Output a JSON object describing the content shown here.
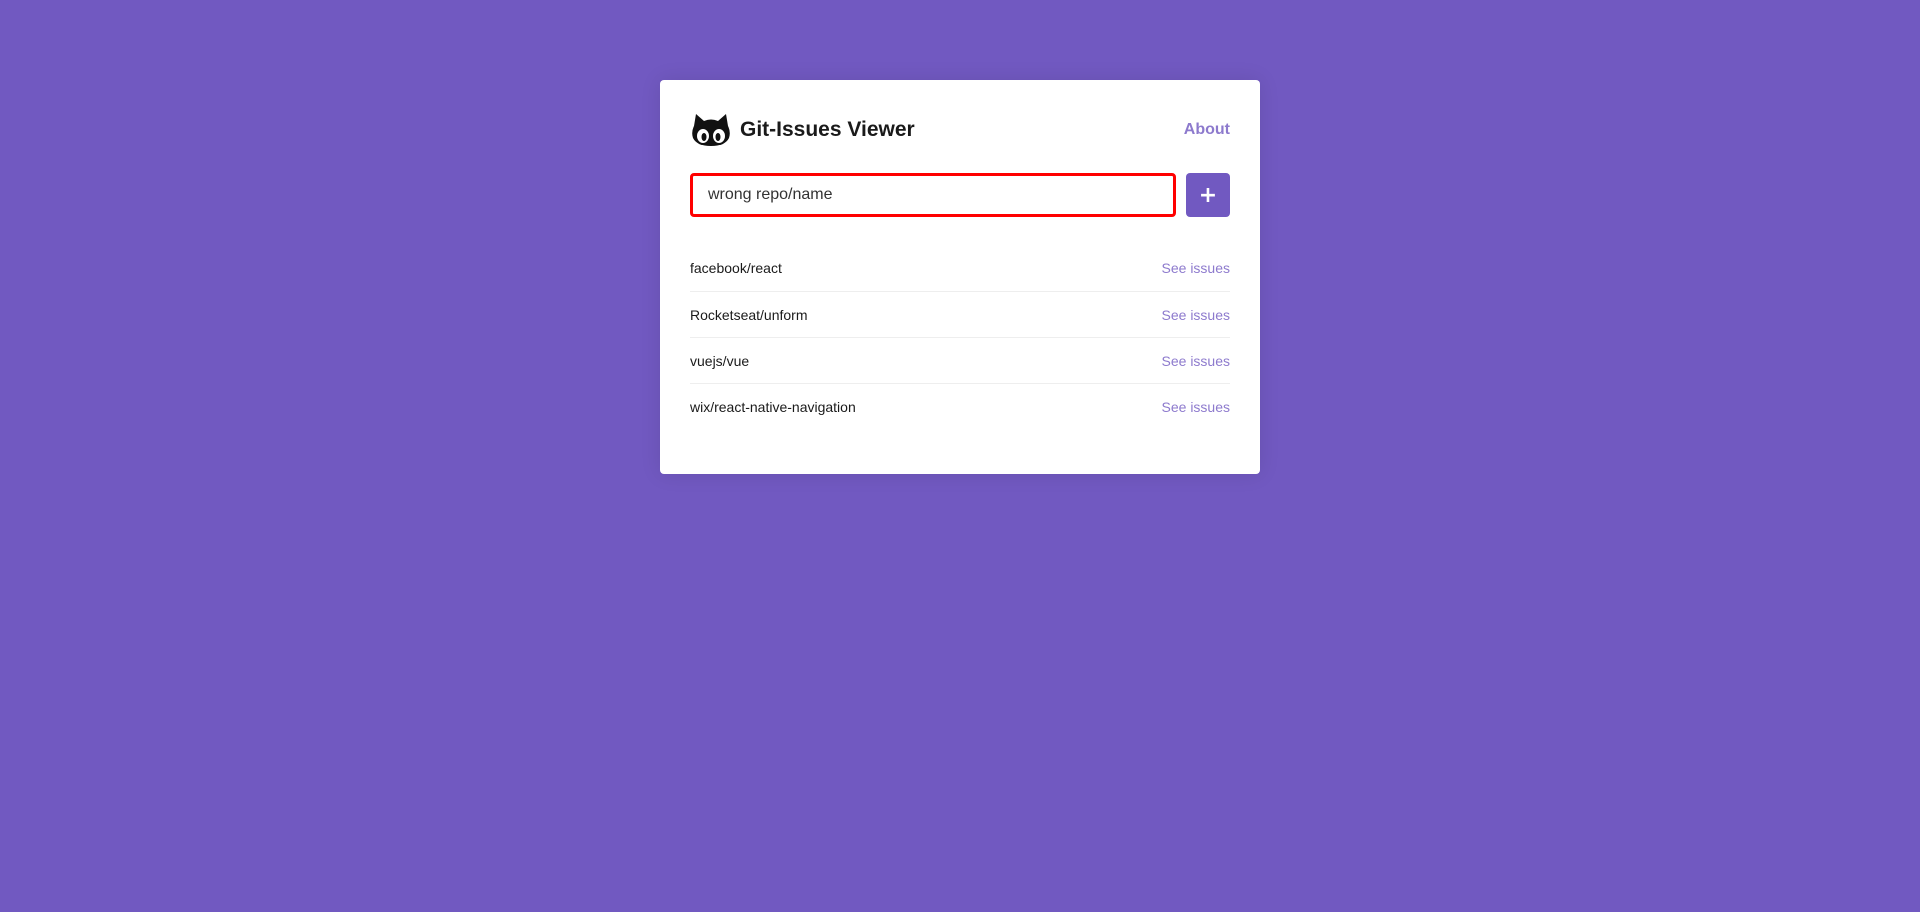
{
  "app": {
    "title": "Git-Issues Viewer",
    "about_label": "About",
    "logo_icon": "octocat-icon"
  },
  "form": {
    "input_value": "wrong repo/name",
    "input_state": "error",
    "add_button_label": "+"
  },
  "repositories": [
    {
      "name": "facebook/react",
      "link_label": "See issues"
    },
    {
      "name": "Rocketseat/unform",
      "link_label": "See issues"
    },
    {
      "name": "vuejs/vue",
      "link_label": "See issues"
    },
    {
      "name": "wix/react-native-navigation",
      "link_label": "See issues"
    }
  ],
  "colors": {
    "background": "#7159c1",
    "accent": "#7159c1",
    "error_border": "#ff0000",
    "card": "#ffffff"
  }
}
